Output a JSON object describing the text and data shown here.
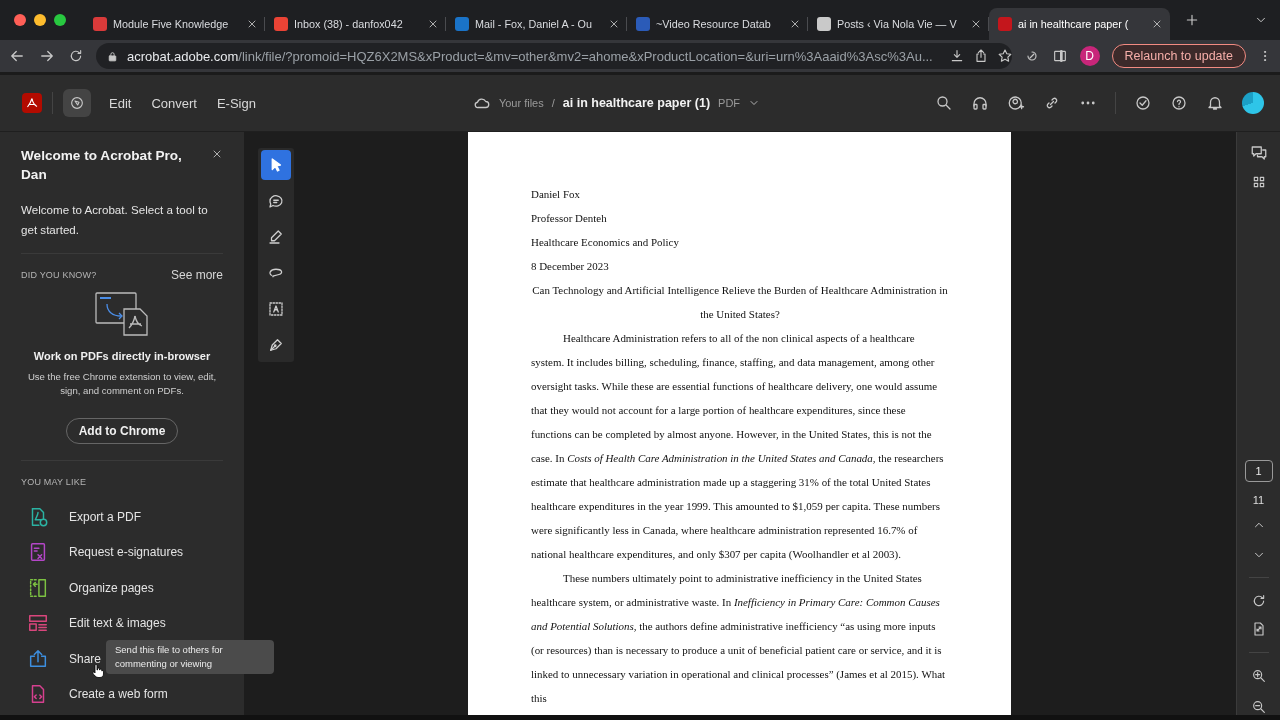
{
  "browser": {
    "tabs": [
      {
        "title": "Module Five Knowledge",
        "color": "#d93a3a",
        "selected": false
      },
      {
        "title": "Inbox (38) - danfox042",
        "color": "#ea4335",
        "selected": false
      },
      {
        "title": "Mail - Fox, Daniel A - Ou",
        "color": "#1a73c8",
        "selected": false
      },
      {
        "title": "~Video Resource Datab",
        "color": "#2b5bb8",
        "selected": false
      },
      {
        "title": "Posts ‹ Via Nola Vie — V",
        "color": "#c9c9c9",
        "selected": false
      },
      {
        "title": "ai in healthcare paper (",
        "color": "#c4161c",
        "selected": true
      }
    ],
    "address": {
      "host": "acrobat.adobe.com",
      "path": "/link/file/?promoid=HQZ6X2MS&xProduct=&mv=other&mv2=ahome&xProductLocation=&uri=urn%3Aaaid%3Asc%3Au..."
    },
    "profile_initial": "D",
    "relaunch_button": "Relaunch to update"
  },
  "app_bar": {
    "menu": [
      "Edit",
      "Convert",
      "E-Sign"
    ],
    "breadcrumb": "Your files",
    "separator": "/",
    "file_name": "ai in healthcare paper (1)",
    "file_type": "PDF"
  },
  "welcome_panel": {
    "title": "Welcome to Acrobat Pro, Dan",
    "intro": "Welcome to Acrobat. Select a tool to get started.",
    "did_you_know": "DID YOU KNOW?",
    "see_more": "See more",
    "promo_title": "Work on PDFs directly in-browser",
    "promo_text": "Use the free Chrome extension to view, edit, sign, and comment on PDFs.",
    "promo_button": "Add to Chrome",
    "you_may_like": "YOU MAY LIKE",
    "items": [
      {
        "label": "Export a PDF",
        "kind": "export",
        "color": "#2bb3a3"
      },
      {
        "label": "Request e-signatures",
        "kind": "esign",
        "color": "#b446c8"
      },
      {
        "label": "Organize pages",
        "kind": "organize",
        "color": "#7cc242"
      },
      {
        "label": "Edit text & images",
        "kind": "edit",
        "color": "#d9467c"
      },
      {
        "label": "Share",
        "kind": "share",
        "color": "#3d8fe0"
      },
      {
        "label": "Create a web form",
        "kind": "form",
        "color": "#d6408f"
      }
    ],
    "tooltip": "Send this file to others for commenting or viewing"
  },
  "tools": [
    {
      "kind": "select",
      "selected": true
    },
    {
      "kind": "comment",
      "selected": false
    },
    {
      "kind": "draw",
      "selected": false
    },
    {
      "kind": "lasso",
      "selected": false
    },
    {
      "kind": "text",
      "selected": false
    },
    {
      "kind": "sign",
      "selected": false
    }
  ],
  "document": {
    "header_lines": [
      "Daniel Fox",
      "Professor Denteh",
      "Healthcare Economics and Policy",
      "8 December 2023"
    ],
    "title": "Can Technology and Artificial Intelligence Relieve the Burden of Healthcare Administration in the United States?",
    "paragraphs": [
      "Healthcare Administration refers to all of the non clinical aspects of a healthcare system. It includes billing, scheduling, finance, staffing, and data management, among other oversight tasks. While these are essential functions of healthcare delivery, one would assume that they would not account for a large portion of healthcare expenditures, since these functions can be completed by almost anyone. However, in the United States, this is not the case. In *Costs of Health Care Administration in the United States and Canada,* the researchers estimate that healthcare administration made up a staggering 31% of the total United States healthcare expenditures in the year 1999. This amounted to $1,059 per capita. These numbers were significantly less in Canada, where healthcare administration represented 16.7% of national healthcare expenditures, and only $307 per capita (Woolhandler et al 2003).",
      "These numbers ultimately point to administrative inefficiency in the United States healthcare system, or administrative waste. In *Inefficiency in Primary Care: Common Causes and Potential Solutions,* the authors define administrative inefficiency “as using more inputs (or resources) than is necessary to produce a unit of beneficial patient care or service, and it is linked to unnecessary variation in operational and clinical processes” (James et al 2015). What this"
    ]
  },
  "page_nav": {
    "current": "1",
    "total": "11"
  }
}
